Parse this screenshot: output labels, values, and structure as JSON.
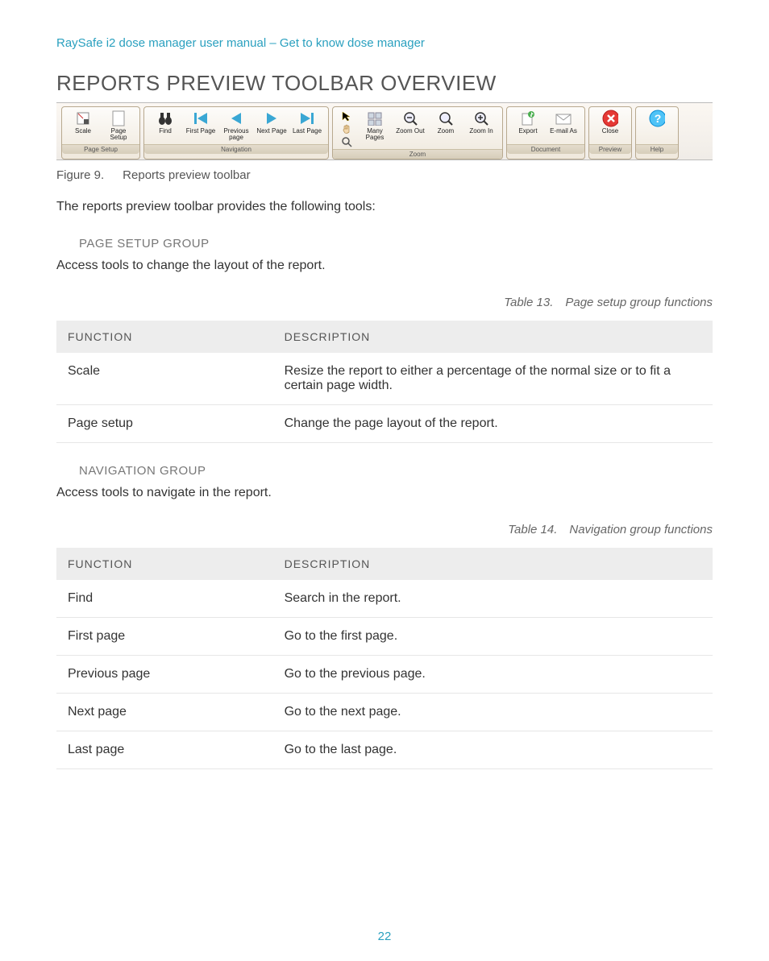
{
  "breadcrumb": "RaySafe i2 dose manager user manual – Get to know dose manager",
  "section_title": "REPORTS PREVIEW TOOLBAR OVERVIEW",
  "figure": {
    "number": "Figure 9.",
    "caption": "Reports preview toolbar"
  },
  "intro_text": "The reports preview toolbar provides the following tools:",
  "toolbar": {
    "groups": [
      {
        "label": "Page Setup",
        "buttons": [
          {
            "name": "scale-button",
            "label": "Scale",
            "icon": "scale-icon"
          },
          {
            "name": "page-setup-button",
            "label": "Page Setup",
            "icon": "page-icon"
          }
        ]
      },
      {
        "label": "Navigation",
        "buttons": [
          {
            "name": "find-button",
            "label": "Find",
            "icon": "binoculars-icon"
          },
          {
            "name": "first-page-button",
            "label": "First Page",
            "icon": "first-arrow-icon"
          },
          {
            "name": "previous-page-button",
            "label": "Previous page",
            "icon": "prev-arrow-icon"
          },
          {
            "name": "next-page-button",
            "label": "Next Page",
            "icon": "next-arrow-icon"
          },
          {
            "name": "last-page-button",
            "label": "Last Page",
            "icon": "last-arrow-icon"
          }
        ]
      },
      {
        "label": "Zoom",
        "mini_icons": [
          "cursor-icon",
          "hand-icon",
          "magnifier-icon"
        ],
        "buttons": [
          {
            "name": "many-pages-button",
            "label": "Many Pages",
            "icon": "many-pages-icon"
          },
          {
            "name": "zoom-out-button",
            "label": "Zoom Out",
            "icon": "zoom-out-icon"
          },
          {
            "name": "zoom-button",
            "label": "Zoom",
            "icon": "zoom-icon"
          },
          {
            "name": "zoom-in-button",
            "label": "Zoom In",
            "icon": "zoom-in-icon"
          }
        ]
      },
      {
        "label": "Document",
        "buttons": [
          {
            "name": "export-button",
            "label": "Export",
            "icon": "export-icon"
          },
          {
            "name": "email-as-button",
            "label": "E-mail As",
            "icon": "email-icon"
          }
        ]
      },
      {
        "label": "Preview",
        "buttons": [
          {
            "name": "close-button",
            "label": "Close",
            "icon": "close-icon"
          }
        ]
      },
      {
        "label": "Help",
        "buttons": [
          {
            "name": "help-button",
            "label": "",
            "icon": "help-icon"
          }
        ]
      }
    ]
  },
  "page_setup_section": {
    "heading": "PAGE SETUP GROUP",
    "text": "Access tools to change the layout of the report.",
    "table_caption": "Table 13. Page setup group functions",
    "table_headers": {
      "func": "FUNCTION",
      "desc": "DESCRIPTION"
    },
    "rows": [
      {
        "func": "Scale",
        "desc": "Resize the report to either a percentage of the normal size or to fit a certain page width."
      },
      {
        "func": "Page setup",
        "desc": "Change the page layout of the report."
      }
    ]
  },
  "navigation_section": {
    "heading": "NAVIGATION GROUP",
    "text": "Access tools to navigate in the report.",
    "table_caption": "Table 14. Navigation group functions",
    "table_headers": {
      "func": "FUNCTION",
      "desc": "DESCRIPTION"
    },
    "rows": [
      {
        "func": "Find",
        "desc": "Search in the report."
      },
      {
        "func": "First page",
        "desc": "Go to the first page."
      },
      {
        "func": "Previous page",
        "desc": "Go to the previous page."
      },
      {
        "func": "Next page",
        "desc": "Go to the next page."
      },
      {
        "func": "Last page",
        "desc": "Go to the last page."
      }
    ]
  },
  "page_number": "22"
}
